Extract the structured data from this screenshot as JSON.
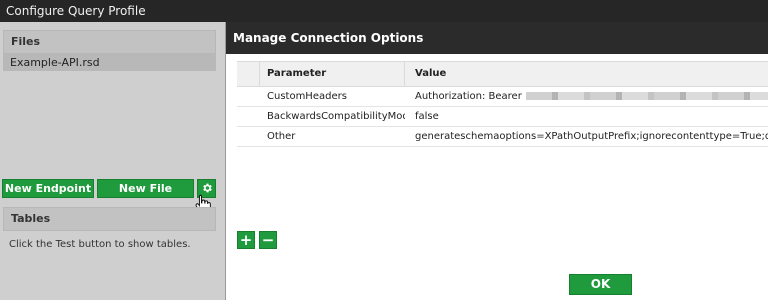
{
  "window": {
    "title": "Configure Query Profile"
  },
  "left_panel": {
    "files_header": "Files",
    "files": [
      {
        "name": "Example-API.rsd"
      }
    ],
    "buttons": {
      "new_endpoint": "New Endpoint",
      "new_file": "New File",
      "settings_icon": "gear-icon"
    },
    "tables_header": "Tables",
    "tables_hint": "Click the Test button to show tables."
  },
  "right_panel": {
    "title": "Manage Connection Options",
    "columns": {
      "parameter": "Parameter",
      "value": "Value"
    },
    "rows": [
      {
        "parameter": "CustomHeaders",
        "value": "Authorization: Bearer"
      },
      {
        "parameter": "BackwardsCompatibilityMode",
        "value": "false"
      },
      {
        "parameter": "Other",
        "value": "generateschemaoptions=XPathOutputPrefix;ignorecontenttype=True;q=SELECT id,name,em"
      }
    ],
    "add_label": "+",
    "remove_label": "−",
    "ok_label": "OK"
  },
  "colors": {
    "accent_green": "#1f9a3d",
    "header_dark": "#2b2b2b",
    "panel_gray": "#cfcfcf"
  }
}
